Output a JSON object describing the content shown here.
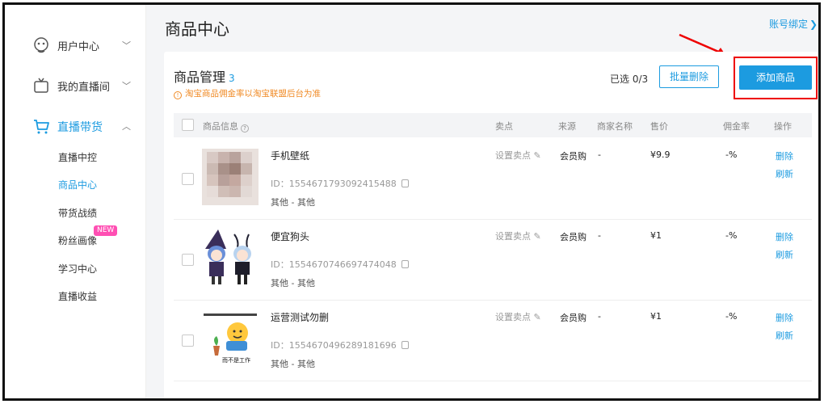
{
  "sidebar": {
    "groups": [
      {
        "label": "用户中心",
        "icon": "user-face-icon"
      },
      {
        "label": "我的直播间",
        "icon": "tv-icon"
      },
      {
        "label": "直播带货",
        "icon": "cart-icon"
      }
    ],
    "sub_items": [
      "直播中控",
      "商品中心",
      "带货战绩",
      "粉丝画像",
      "学习中心",
      "直播收益"
    ],
    "new_badge": "NEW"
  },
  "header": {
    "title": "商品中心",
    "account_link": "账号绑定"
  },
  "product_mgmt": {
    "title": "商品管理",
    "count": "3",
    "warning": "淘宝商品佣金率以淘宝联盟后台为准",
    "selected": "已选 0/3",
    "batch_delete": "批量删除",
    "add_product": "添加商品"
  },
  "table": {
    "headers": {
      "info": "商品信息",
      "selling_point": "卖点",
      "source": "来源",
      "merchant": "商家名称",
      "price": "售价",
      "commission": "佣金率",
      "action": "操作"
    },
    "rows": [
      {
        "name": "手机壁纸",
        "id": "ID：1554671793092415488",
        "category": "其他 - 其他",
        "selling_point": "设置卖点",
        "source": "会员购",
        "merchant": "-",
        "price": "¥9.9",
        "commission": "-%",
        "delete": "删除",
        "refresh": "刷新"
      },
      {
        "name": "便宜狗头",
        "id": "ID：1554670746697474048",
        "category": "其他 - 其他",
        "selling_point": "设置卖点",
        "source": "会员购",
        "merchant": "-",
        "price": "¥1",
        "commission": "-%",
        "delete": "删除",
        "refresh": "刷新"
      },
      {
        "name": "运营测试勿删",
        "id": "ID：1554670496289181696",
        "category": "其他 - 其他",
        "selling_point": "设置卖点",
        "source": "会员购",
        "merchant": "-",
        "price": "¥1",
        "commission": "-%",
        "delete": "删除",
        "refresh": "刷新",
        "thumb_caption": "而不是工作"
      }
    ]
  },
  "colors": {
    "accent": "#1c9be0",
    "warning": "#f08a24",
    "highlight": "#ee0000"
  }
}
